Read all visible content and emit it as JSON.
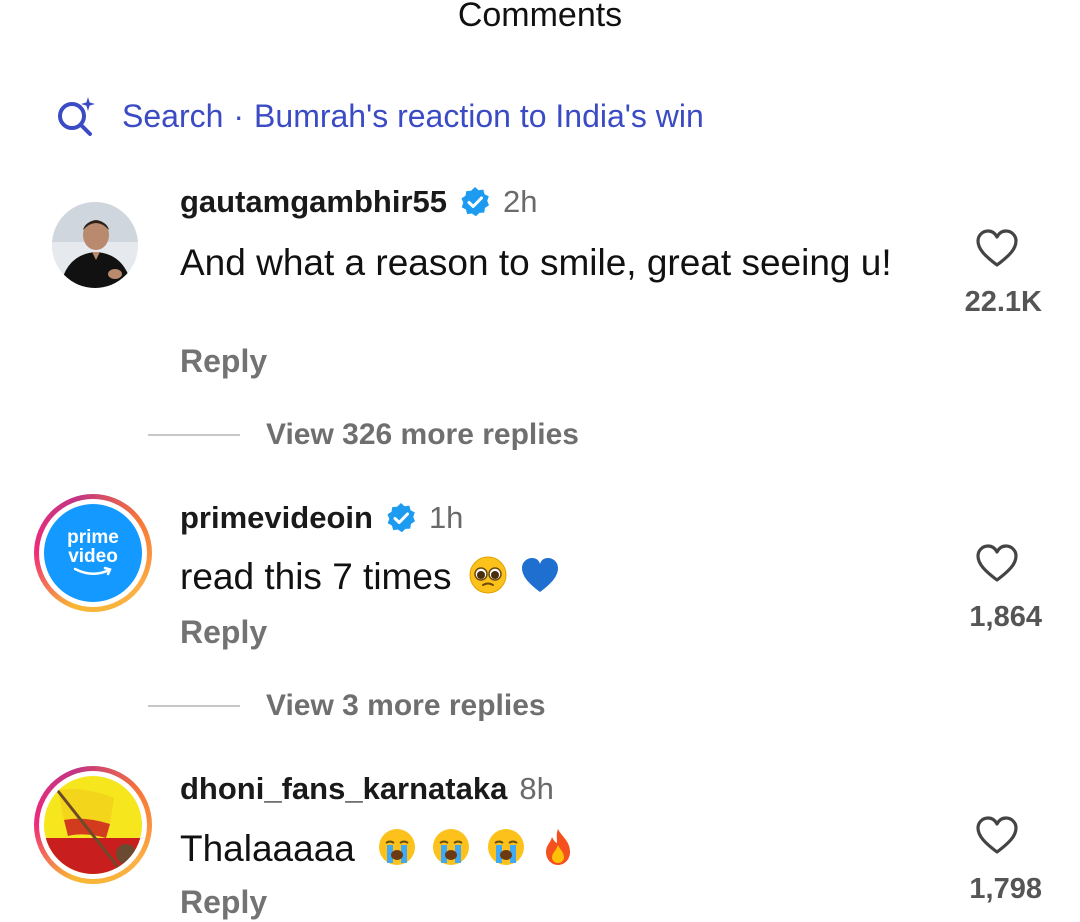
{
  "sheet": {
    "title": "Comments"
  },
  "search": {
    "prefix": "Search",
    "separator": "·",
    "query": "Bumrah's reaction to India's win"
  },
  "comments": [
    {
      "username": "gautamgambhir55",
      "verified": true,
      "time": "2h",
      "text": "And what a reason to smile, great seeing u!",
      "likes": "22.1K",
      "reply_label": "Reply",
      "view_more": "View 326 more replies",
      "avatar": "person-photo"
    },
    {
      "username": "primevideoin",
      "verified": true,
      "time": "1h",
      "text": "read this 7 times",
      "emojis": [
        "pleading-face-emoji",
        "blue-heart-emoji"
      ],
      "likes": "1,864",
      "reply_label": "Reply",
      "view_more": "View 3 more replies",
      "avatar": "prime-video-logo",
      "avatar_logo": {
        "line1": "prime",
        "line2": "video"
      }
    },
    {
      "username": "dhoni_fans_karnataka",
      "verified": false,
      "time": "8h",
      "text": "Thalaaaaa",
      "emojis": [
        "crying-face-emoji",
        "crying-face-emoji",
        "crying-face-emoji",
        "fire-emoji"
      ],
      "likes": "1,798",
      "reply_label": "Reply",
      "avatar": "karnataka-flag-photo"
    }
  ],
  "colors": {
    "link_blue": "#3b4bc4",
    "verified_blue": "#1d9bf0",
    "muted_gray": "#737373",
    "prime_blue": "#1399ff"
  }
}
